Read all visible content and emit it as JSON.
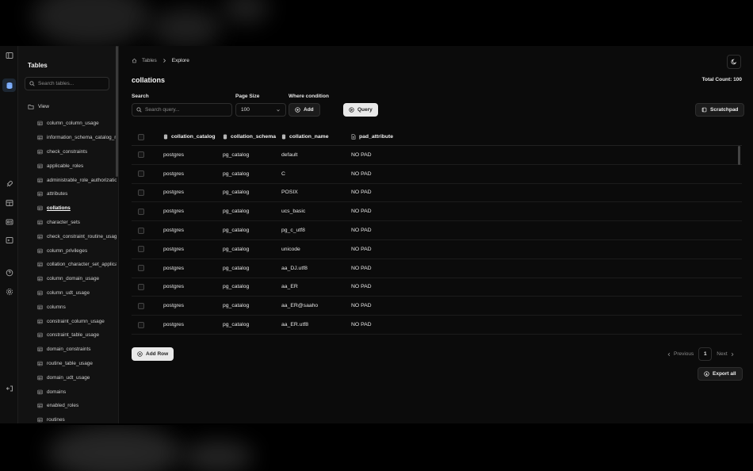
{
  "sidebar": {
    "title": "Tables",
    "search_placeholder": "Search tables...",
    "group_label": "View",
    "items": [
      {
        "label": "column_column_usage"
      },
      {
        "label": "information_schema_catalog_name"
      },
      {
        "label": "check_constraints"
      },
      {
        "label": "applicable_roles"
      },
      {
        "label": "administrable_role_authorizations"
      },
      {
        "label": "attributes"
      },
      {
        "label": "collations",
        "active": true
      },
      {
        "label": "character_sets"
      },
      {
        "label": "check_constraint_routine_usage"
      },
      {
        "label": "column_privileges"
      },
      {
        "label": "collation_character_set_applicability"
      },
      {
        "label": "column_domain_usage"
      },
      {
        "label": "column_udt_usage"
      },
      {
        "label": "columns"
      },
      {
        "label": "constraint_column_usage"
      },
      {
        "label": "constraint_table_usage"
      },
      {
        "label": "domain_constraints"
      },
      {
        "label": "routine_table_usage"
      },
      {
        "label": "domain_udt_usage"
      },
      {
        "label": "domains"
      },
      {
        "label": "enabled_roles"
      },
      {
        "label": "routines"
      }
    ]
  },
  "breadcrumb": {
    "root": "Tables",
    "current": "Explore"
  },
  "page": {
    "title": "collations",
    "total_count": "Total Count: 100"
  },
  "controls": {
    "search_label": "Search",
    "search_placeholder": "Search query...",
    "page_size_label": "Page Size",
    "page_size_value": "100",
    "where_label": "Where condition",
    "add_label": "Add",
    "query_label": "Query",
    "scratchpad_label": "Scratchpad"
  },
  "table": {
    "columns": [
      "collation_catalog",
      "collation_schema",
      "collation_name",
      "pad_attribute"
    ],
    "rows": [
      [
        "postgres",
        "pg_catalog",
        "default",
        "NO PAD"
      ],
      [
        "postgres",
        "pg_catalog",
        "C",
        "NO PAD"
      ],
      [
        "postgres",
        "pg_catalog",
        "POSIX",
        "NO PAD"
      ],
      [
        "postgres",
        "pg_catalog",
        "ucs_basic",
        "NO PAD"
      ],
      [
        "postgres",
        "pg_catalog",
        "pg_c_utf8",
        "NO PAD"
      ],
      [
        "postgres",
        "pg_catalog",
        "unicode",
        "NO PAD"
      ],
      [
        "postgres",
        "pg_catalog",
        "aa_DJ.utf8",
        "NO PAD"
      ],
      [
        "postgres",
        "pg_catalog",
        "aa_ER",
        "NO PAD"
      ],
      [
        "postgres",
        "pg_catalog",
        "aa_ER@saaho",
        "NO PAD"
      ],
      [
        "postgres",
        "pg_catalog",
        "aa_ER.utf8",
        "NO PAD"
      ]
    ]
  },
  "footer": {
    "add_row_label": "Add Row",
    "previous_label": "Previous",
    "page_number": "1",
    "next_label": "Next",
    "export_label": "Export all"
  },
  "rail_icons": [
    "sidebar-toggle-icon",
    "database-icon",
    "rocket-icon",
    "table-icon",
    "id-card-icon",
    "terminal-icon",
    "help-icon",
    "settings-icon",
    "logout-icon"
  ],
  "colors": {
    "background": "#0b0b0b",
    "sidebar": "#121212",
    "accent": "#7fb0ff",
    "button_light": "#e9e9e9"
  }
}
